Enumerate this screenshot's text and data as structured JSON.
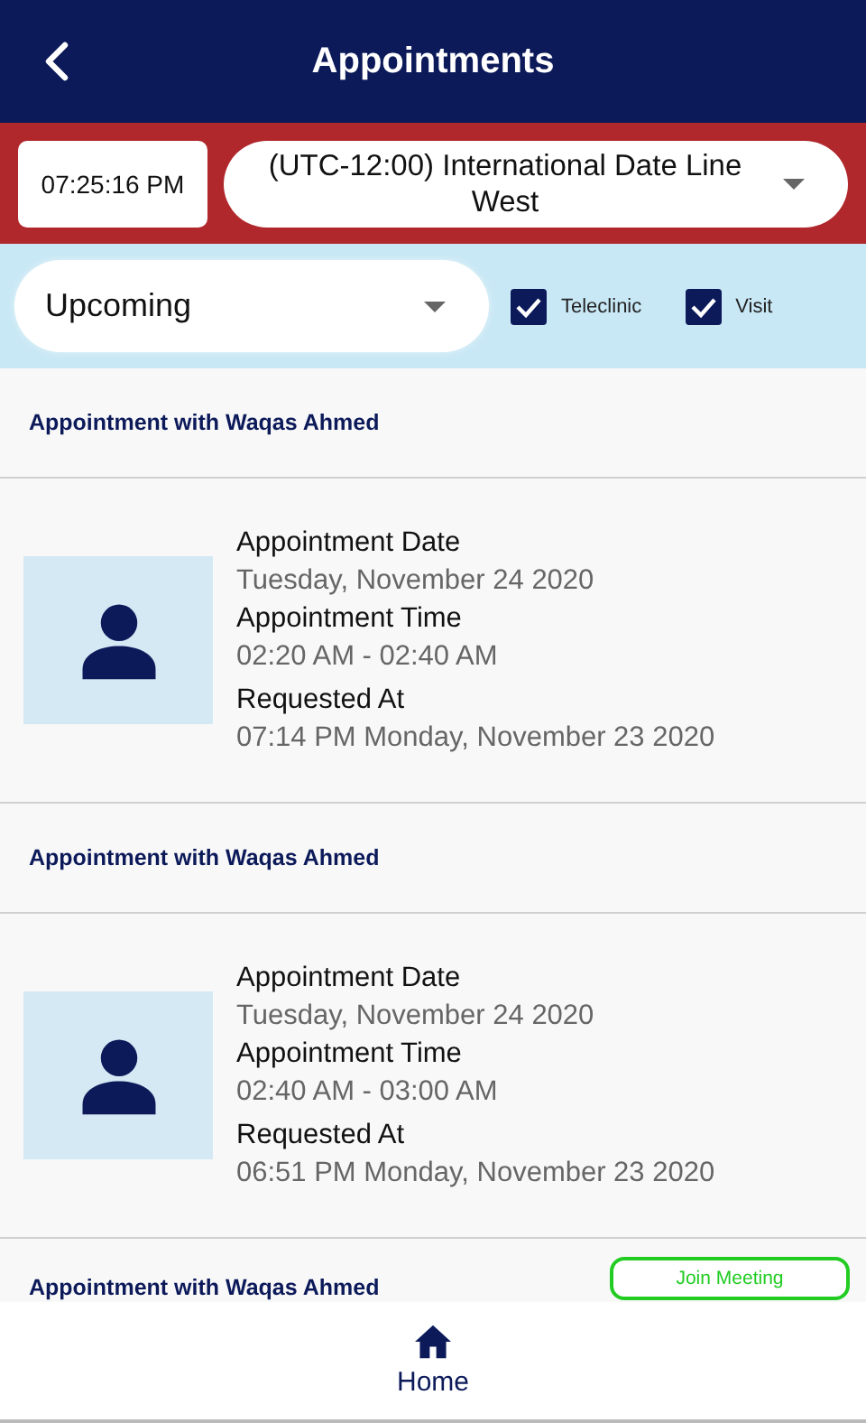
{
  "header": {
    "title": "Appointments"
  },
  "time": "07:25:16 PM",
  "timezone": "(UTC-12:00) International Date Line West",
  "filter": {
    "value": "Upcoming"
  },
  "checkboxes": [
    {
      "label": "Teleclinic",
      "checked": true
    },
    {
      "label": "Visit",
      "checked": true
    }
  ],
  "appointments": [
    {
      "title": "Appointment with Waqas Ahmed",
      "date_label": "Appointment Date",
      "date": "Tuesday, November 24 2020",
      "time_label": "Appointment Time",
      "time": "02:20 AM - 02:40 AM",
      "requested_label": "Requested At",
      "requested": "07:14 PM Monday, November 23 2020"
    },
    {
      "title": "Appointment with Waqas Ahmed",
      "date_label": "Appointment Date",
      "date": "Tuesday, November 24 2020",
      "time_label": "Appointment Time",
      "time": "02:40 AM - 03:00 AM",
      "requested_label": "Requested At",
      "requested": "06:51 PM Monday, November 23 2020"
    },
    {
      "title": "Appointment with Waqas Ahmed",
      "join_button": "Join Meeting"
    }
  ],
  "nav": [
    {
      "label": "Home",
      "selected": true
    }
  ]
}
